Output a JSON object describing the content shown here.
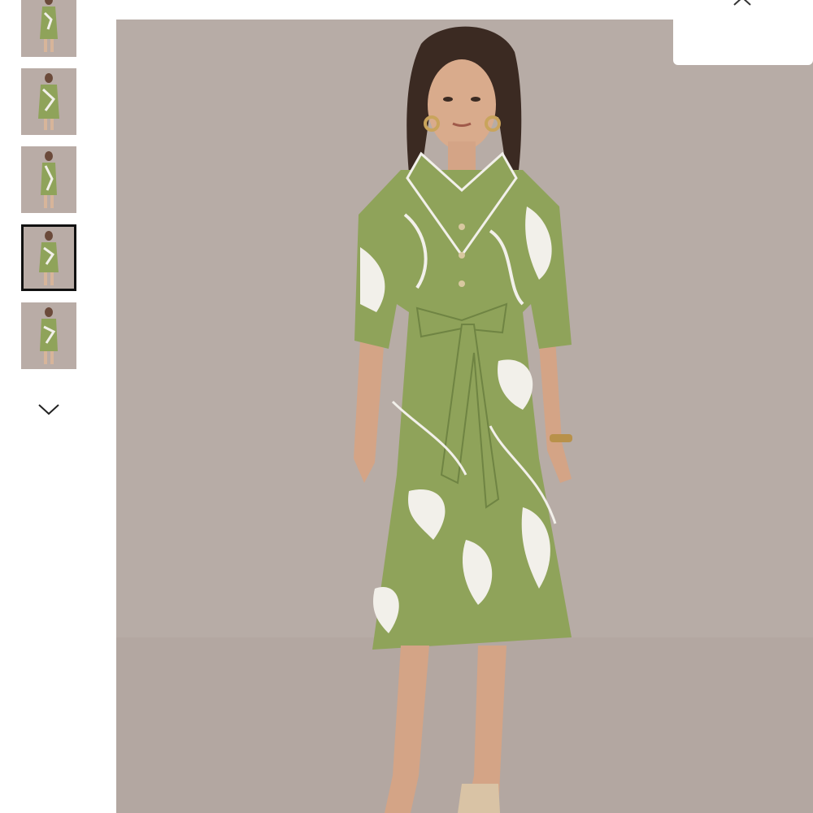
{
  "viewer": {
    "thumbnails": [
      {
        "alt": "thumbnail-1",
        "selected": false
      },
      {
        "alt": "thumbnail-2",
        "selected": false
      },
      {
        "alt": "thumbnail-3",
        "selected": false
      },
      {
        "alt": "thumbnail-4",
        "selected": true
      },
      {
        "alt": "thumbnail-5",
        "selected": false
      }
    ],
    "icons": {
      "close": "close-icon",
      "next": "chevron-down-icon"
    },
    "colors": {
      "background": "#b7aca6",
      "dress_green": "#8fa35a",
      "dress_white": "#f2f0ea",
      "selected_border": "#111111"
    }
  }
}
